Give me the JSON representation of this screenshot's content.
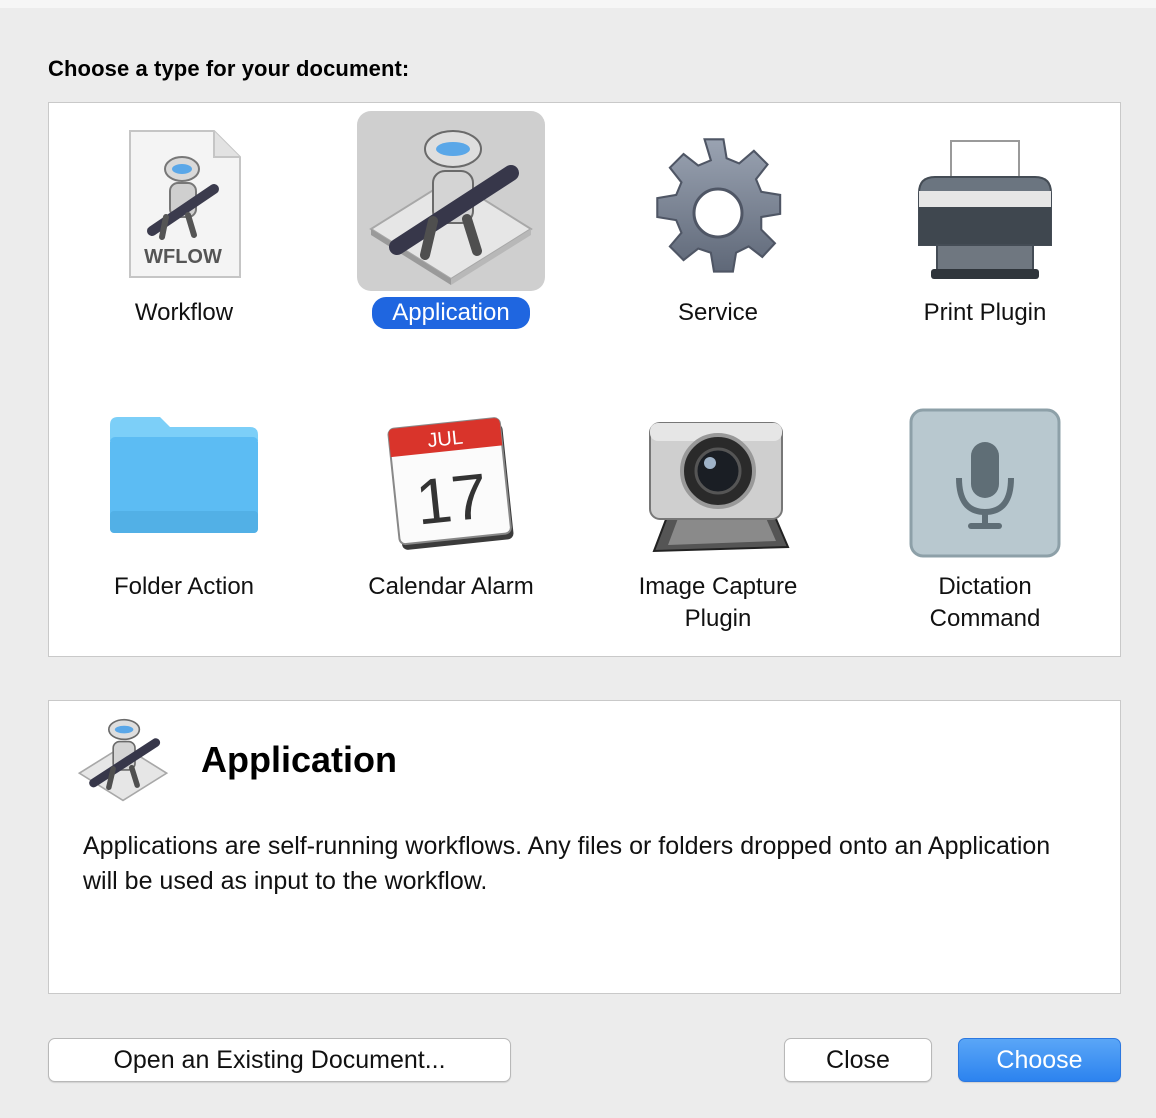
{
  "prompt": "Choose a type for your document:",
  "types": [
    {
      "label": "Workflow",
      "icon": "workflow-document-icon",
      "badge": "WFLOW"
    },
    {
      "label": "Application",
      "icon": "automator-robot-icon",
      "selected": true
    },
    {
      "label": "Service",
      "icon": "gear-icon"
    },
    {
      "label": "Print Plugin",
      "icon": "printer-icon"
    },
    {
      "label": "Folder Action",
      "icon": "folder-icon"
    },
    {
      "label": "Calendar Alarm",
      "icon": "calendar-icon",
      "month": "JUL",
      "day": "17"
    },
    {
      "label_line1": "Image Capture",
      "label_line2": "Plugin",
      "icon": "camera-icon"
    },
    {
      "label_line1": "Dictation",
      "label_line2": "Command",
      "icon": "microphone-icon"
    }
  ],
  "description": {
    "icon": "automator-robot-icon",
    "title": "Application",
    "text": "Applications are self-running workflows. Any files or folders dropped onto an Application will be used as input to the workflow."
  },
  "buttons": {
    "open_existing": "Open an Existing Document...",
    "close": "Close",
    "choose": "Choose"
  },
  "colors": {
    "selection": "#1f66e0",
    "primary_button": "#2c83ef",
    "folder": "#5cbcf3",
    "calendar_red": "#d9342b"
  }
}
